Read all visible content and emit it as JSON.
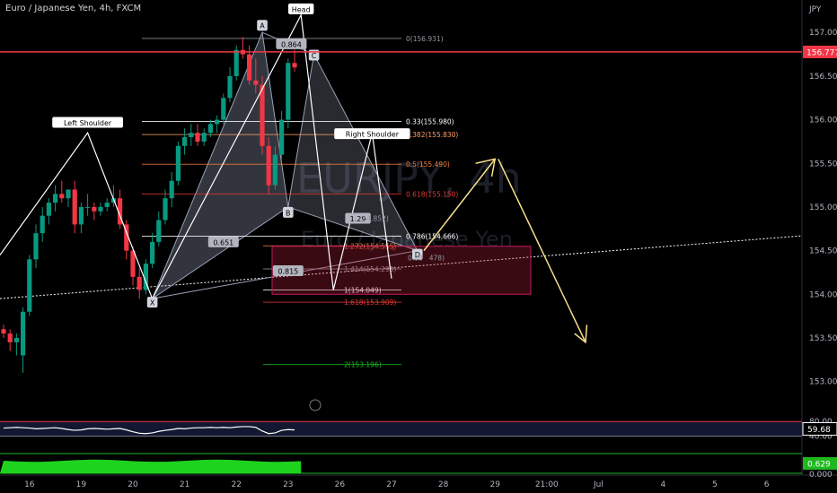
{
  "header": {
    "symbol_title": "Euro / Japanese Yen, 4h, FXCM",
    "currency": "JPY",
    "watermark_symbol": "EURJPY, 4h",
    "watermark_name": "Euro / Japanese Yen"
  },
  "chart_data": {
    "type": "candlestick",
    "title": "Euro / Japanese Yen, 4h, FXCM",
    "ylabel": "JPY",
    "ylim": [
      152.75,
      157.3
    ],
    "y_ticks": [
      "157.000",
      "156.500",
      "156.000",
      "155.500",
      "155.000",
      "154.500",
      "154.000",
      "153.500",
      "153.000"
    ],
    "y_tick_values": [
      157.0,
      156.5,
      156.0,
      155.5,
      155.0,
      154.5,
      154.0,
      153.5,
      153.0
    ],
    "x_ticks": [
      "16",
      "19",
      "20",
      "21",
      "22",
      "23",
      "26",
      "27",
      "28",
      "29",
      "21:00",
      "Jul",
      "4",
      "5",
      "6"
    ],
    "x_tick_index": [
      4,
      12,
      20,
      28,
      36,
      44,
      52,
      60,
      68,
      76,
      84,
      92,
      102,
      110,
      118
    ],
    "candles": [
      [
        153.6,
        153.65,
        153.5,
        153.55
      ],
      [
        153.55,
        153.6,
        153.35,
        153.45
      ],
      [
        153.45,
        153.55,
        153.3,
        153.5
      ],
      [
        153.3,
        153.85,
        153.1,
        153.8
      ],
      [
        153.8,
        154.45,
        153.75,
        154.4
      ],
      [
        154.4,
        154.8,
        154.3,
        154.7
      ],
      [
        154.7,
        155.0,
        154.6,
        154.9
      ],
      [
        154.9,
        155.1,
        154.8,
        155.05
      ],
      [
        155.05,
        155.25,
        154.95,
        155.15
      ],
      [
        155.15,
        155.3,
        155.05,
        155.1
      ],
      [
        155.1,
        155.2,
        155.0,
        155.2
      ],
      [
        155.2,
        155.3,
        154.7,
        154.8
      ],
      [
        154.8,
        155.05,
        154.7,
        155.0
      ],
      [
        155.0,
        155.15,
        154.9,
        155.0
      ],
      [
        155.0,
        155.05,
        154.85,
        154.95
      ],
      [
        154.95,
        155.05,
        154.9,
        155.0
      ],
      [
        155.0,
        155.1,
        154.95,
        155.05
      ],
      [
        155.05,
        155.25,
        155.0,
        155.1
      ],
      [
        155.1,
        155.2,
        154.75,
        154.8
      ],
      [
        154.8,
        154.85,
        154.4,
        154.5
      ],
      [
        154.5,
        154.55,
        154.1,
        154.2
      ],
      [
        154.2,
        154.3,
        153.95,
        154.05
      ],
      [
        154.05,
        154.4,
        154.0,
        154.35
      ],
      [
        154.35,
        154.7,
        154.3,
        154.6
      ],
      [
        154.6,
        154.95,
        154.55,
        154.85
      ],
      [
        154.85,
        155.2,
        154.8,
        155.1
      ],
      [
        155.1,
        155.4,
        155.0,
        155.3
      ],
      [
        155.3,
        155.75,
        155.25,
        155.7
      ],
      [
        155.7,
        155.9,
        155.6,
        155.8
      ],
      [
        155.8,
        155.95,
        155.7,
        155.85
      ],
      [
        155.85,
        155.95,
        155.7,
        155.75
      ],
      [
        155.75,
        155.9,
        155.7,
        155.85
      ],
      [
        155.85,
        156.0,
        155.8,
        155.95
      ],
      [
        155.95,
        156.05,
        155.85,
        156.0
      ],
      [
        156.0,
        156.3,
        155.95,
        156.25
      ],
      [
        156.25,
        156.6,
        156.2,
        156.5
      ],
      [
        156.5,
        156.85,
        156.45,
        156.8
      ],
      [
        156.8,
        156.95,
        156.7,
        156.75
      ],
      [
        156.75,
        156.85,
        156.4,
        156.45
      ],
      [
        156.45,
        156.7,
        156.3,
        156.4
      ],
      [
        156.4,
        156.5,
        155.6,
        155.7
      ],
      [
        155.7,
        155.8,
        155.15,
        155.25
      ],
      [
        155.25,
        155.7,
        155.2,
        155.6
      ],
      [
        155.6,
        156.1,
        155.55,
        156.0
      ],
      [
        156.0,
        156.7,
        155.9,
        156.65
      ],
      [
        156.65,
        156.8,
        156.55,
        156.6
      ]
    ],
    "horizontal_level": {
      "value": 156.777,
      "label": "156.777",
      "color": "#f23645"
    },
    "fibonacci_levels": [
      {
        "label": "0(156.931)",
        "value": 156.931,
        "color": "#9598a1"
      },
      {
        "label": "0.33(155.980)",
        "value": 155.98,
        "color": "#ffffff"
      },
      {
        "label": "0.382(155.830)",
        "value": 155.83,
        "color": "#ffa06b"
      },
      {
        "label": "0.5(155.490)",
        "value": 155.49,
        "color": "#f57c3d"
      },
      {
        "label": "0.618(155.150)",
        "value": 155.15,
        "color": "#e53935"
      },
      {
        "label": "0.786(154.666)",
        "value": 154.666,
        "color": "#ffffff"
      },
      {
        "label": "1(154.049)",
        "value": 154.049,
        "color": "#ffffff"
      },
      {
        "label": "1.272(154.555)",
        "value": 154.555,
        "color": "#f57c3d"
      },
      {
        "label": "1.414(154.290)",
        "value": 154.29,
        "color": "#9598a1"
      },
      {
        "label": "1.618(153.909)",
        "value": 153.909,
        "color": "#e53935"
      },
      {
        "label": "2(153.196)",
        "value": 153.196,
        "color": "#1fb81f"
      }
    ],
    "pattern_labels": {
      "left_shoulder": "Left Shoulder",
      "head": "Head",
      "right_shoulder": "Right Shoulder",
      "point_a": "A",
      "point_b": "B",
      "point_c": "C",
      "point_d": "D",
      "point_x": "X",
      "ratio_ab": "0.864",
      "ratio_xb": "0.651",
      "ratio_bd": "0.815",
      "ratio_cd": "1.29",
      "partial_fib_label": "54.852)",
      "partial_fib_label_2": "0.88",
      "partial_fib_label_3": "478)"
    },
    "rsi": {
      "upper": "80.00",
      "lower": "40.00",
      "value": "59.68",
      "values": [
        62,
        63,
        64,
        63,
        62,
        60,
        61,
        62,
        63,
        61,
        58,
        56,
        57,
        60,
        61,
        60,
        59,
        60,
        61,
        57,
        52,
        48,
        47,
        49,
        53,
        56,
        58,
        61,
        60,
        62,
        63,
        63,
        64,
        63,
        64,
        63,
        65,
        66,
        66,
        64,
        54,
        47,
        49,
        56,
        58,
        57
      ]
    },
    "oscillator": {
      "value": "0.629",
      "zero_label": "0.000"
    }
  },
  "colors": {
    "bull": "#089981",
    "bear": "#f23645",
    "background": "#000000",
    "accent": "#f2c94c"
  }
}
